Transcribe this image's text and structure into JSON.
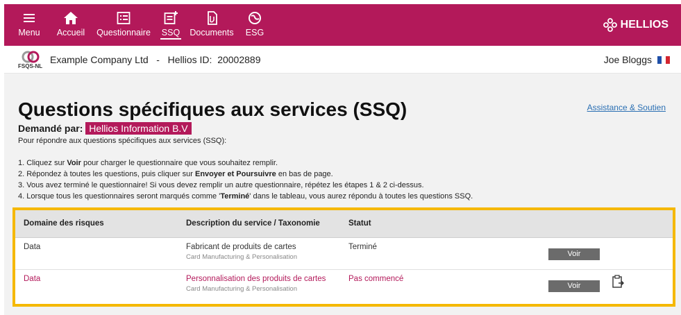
{
  "nav": {
    "items": [
      {
        "label": "Menu",
        "icon": "menu-icon"
      },
      {
        "label": "Accueil",
        "icon": "home-icon"
      },
      {
        "label": "Questionnaire",
        "icon": "questionnaire-icon"
      },
      {
        "label": "SSQ",
        "icon": "ssq-icon"
      },
      {
        "label": "Documents",
        "icon": "documents-icon"
      },
      {
        "label": "ESG",
        "icon": "esg-icon"
      }
    ],
    "brand": "HELLIOS"
  },
  "subheader": {
    "logo_text": "FSQS-NL",
    "company": "Example Company Ltd   -   Hellios ID:  20002889",
    "user": "Joe Bloggs"
  },
  "page": {
    "title": "Questions spécifiques aux services (SSQ)",
    "help_link": "Assistance & Soutien",
    "requested_label": "Demandé par:",
    "requested_by": "Hellios Information B.V",
    "intro": "Pour répondre aux questions spécifiques aux services (SSQ):",
    "steps": {
      "s1_a": "1. Cliquez sur ",
      "s1_b": "Voir",
      "s1_c": " pour charger le questionnaire que vous souhaitez remplir.",
      "s2_a": "2. Répondez à toutes les questions, puis cliquer sur ",
      "s2_b": "Envoyer et Poursuivre",
      "s2_c": " en bas de page.",
      "s3": "3. Vous avez terminé le questionnaire! Si vous devez remplir un autre questionnaire, répétez les étapes 1 & 2 ci-dessus.",
      "s4_a": "4. Lorsque tous les questionnaires seront marqués comme '",
      "s4_b": "Terminé",
      "s4_c": "' dans le tableau, vous aurez répondu à toutes les questions SSQ."
    }
  },
  "table": {
    "headers": {
      "domain": "Domaine des risques",
      "description": "Description du service / Taxonomie",
      "status": "Statut"
    },
    "rows": [
      {
        "domain": "Data",
        "description": "Fabricant de produits de cartes",
        "taxonomy": "Card Manufacturing & Personalisation",
        "status": "Terminé",
        "action": "Voir"
      },
      {
        "domain": "Data",
        "description": "Personnalisation des produits de cartes",
        "taxonomy": "Card Manufacturing & Personalisation",
        "status": "Pas commencé",
        "action": "Voir"
      }
    ]
  },
  "colors": {
    "brand": "#b3195a",
    "highlight": "#f5b800"
  }
}
